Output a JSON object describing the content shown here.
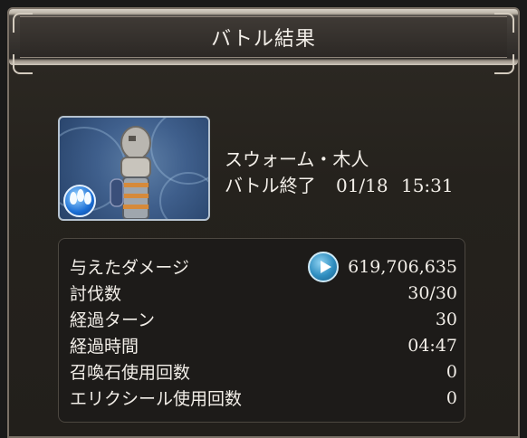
{
  "window": {
    "title": "バトル結果"
  },
  "enemy": {
    "name": "スウォーム・木人",
    "status_label": "バトル終了",
    "date": "01/18",
    "time": "15:31",
    "element_icon": "water-element-icon"
  },
  "stats": [
    {
      "label": "与えたダメージ",
      "value": "619,706,635"
    },
    {
      "label": "討伐数",
      "value": "30/30"
    },
    {
      "label": "経過ターン",
      "value": "30"
    },
    {
      "label": "経過時間",
      "value": "04:47"
    },
    {
      "label": "召喚石使用回数",
      "value": "0"
    },
    {
      "label": "エリクシール使用回数",
      "value": "0"
    }
  ],
  "colors": {
    "text": "#f2eee8",
    "panel": "#1d1b19",
    "accent_blue": "#2f8ec0"
  }
}
